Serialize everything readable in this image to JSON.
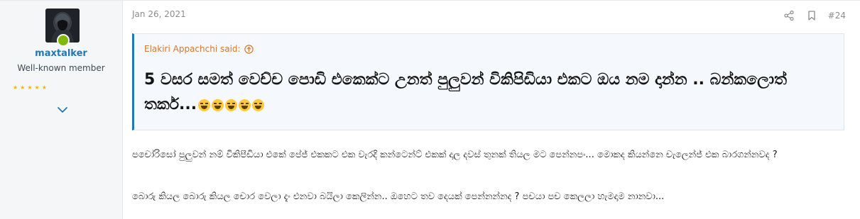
{
  "author": {
    "username": "maxtalker",
    "title": "Well-known member",
    "stars": "★★★★★"
  },
  "post": {
    "date": "Jan 26, 2021",
    "number": "#24",
    "quote": {
      "attribution": "Elakiri Appachchi said:",
      "text": "5 වසර සමත් වෙච්ච පොඩි එකෙක්ට උනත් පුලුවන් විකිපිඩියා එකට ඔය නම දාන්න .. බන්කලොත් තර්ක...",
      "emoji_count": 5
    },
    "paragraphs": [
      "පචෝරිසෝ පුලුවන් නම් විකිපීඩියා එකේ පේජ් එකකට එක වැරදි කන්ටෙන්ට් එකක් දාල දවස් තුනක් තියල මට පෙන්නපං... මොකද කියන්නෙ චැලෙන්ජ් එක බාරගන්නවද ?",
      "බොරු කියල බොරු කියල චොර වෙලා දැං එනවා බයිලා කෙලින්න.. ඔහෙට තව දෙයක් පෙන්නන්නද ? පචයා පච කෙලලා හැමදාම නානවා..."
    ]
  },
  "icons": {
    "share": "share-icon",
    "bookmark": "bookmark-icon",
    "expand": "chevron-down-icon",
    "quote_jump": "arrow-up-circle-icon",
    "online": "online-status-icon",
    "emoji": "laughing-emoji-icon"
  },
  "colors": {
    "link": "#2577b1",
    "quote_attribution": "#d9762d",
    "online": "#7fb900",
    "stars": "#f2b600"
  }
}
